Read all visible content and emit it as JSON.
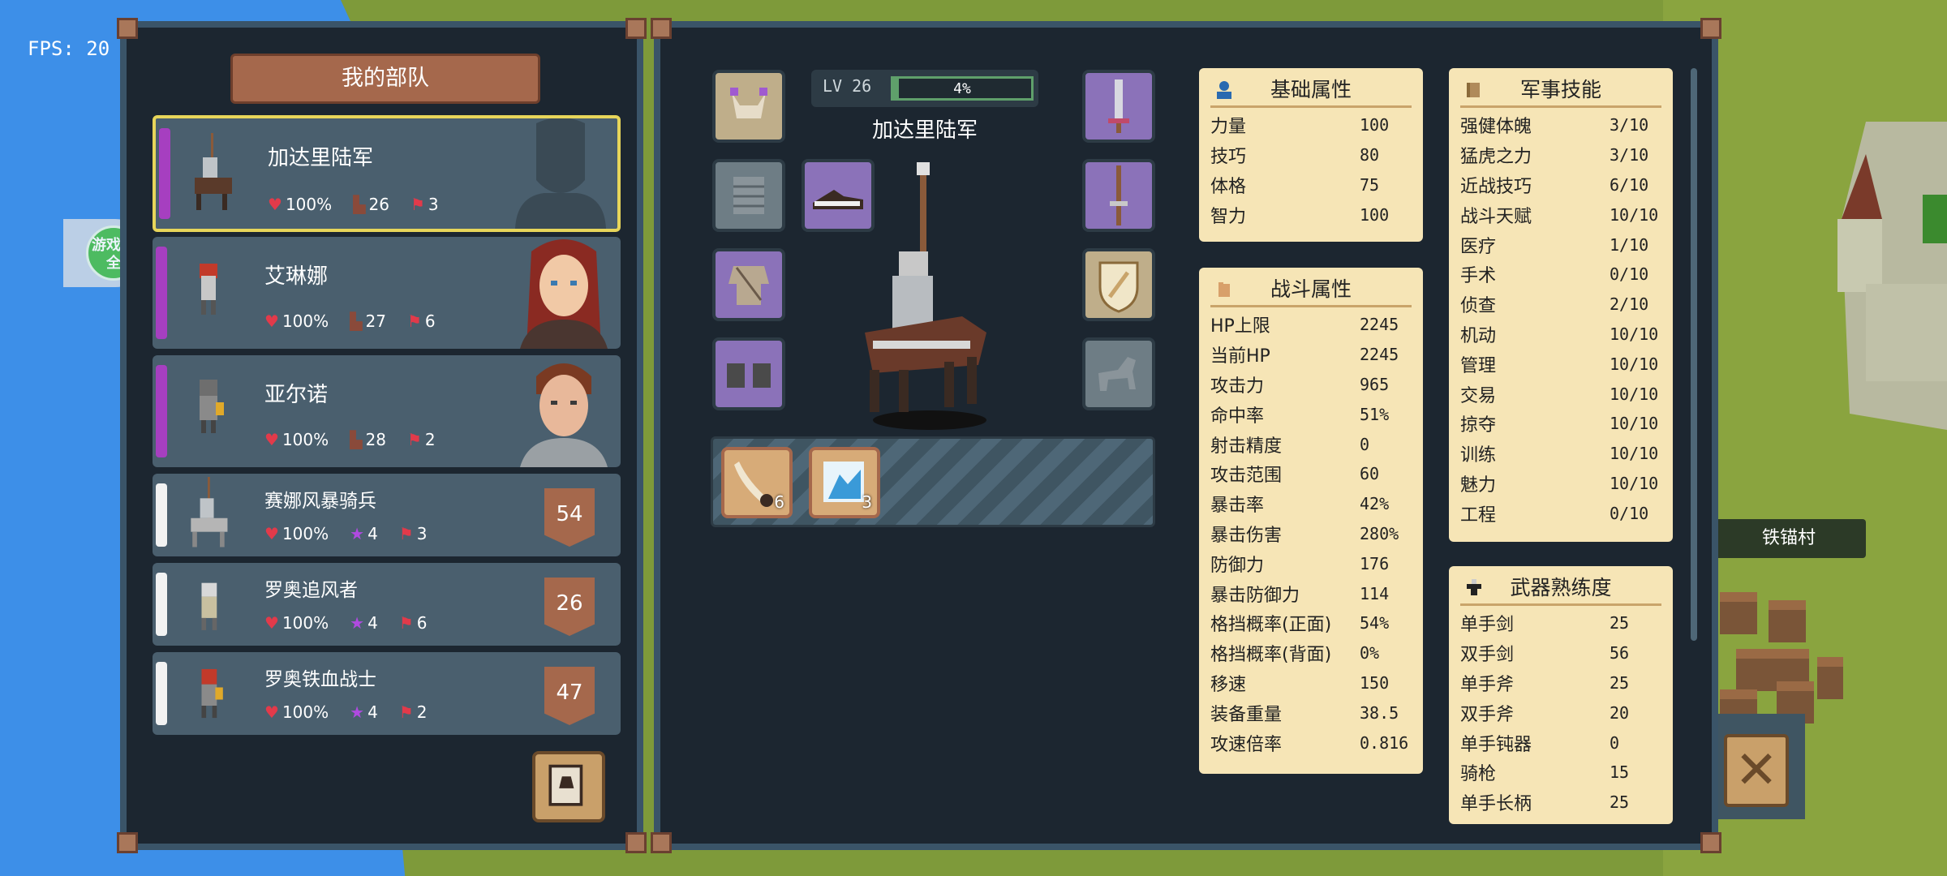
{
  "hud": {
    "fps": "FPS: 20"
  },
  "overlay": {
    "game_box_label": "游戏大全"
  },
  "map": {
    "village_label": "铁锚村"
  },
  "troops": {
    "title": "我的部队",
    "units": [
      {
        "name": "加达里陆军",
        "hp": "100%",
        "level": "26",
        "count": "3",
        "selected": true,
        "bar_color": "#a63fc0",
        "badge": "",
        "portrait": "silhouette"
      },
      {
        "name": "艾琳娜",
        "hp": "100%",
        "level": "27",
        "count": "6",
        "selected": false,
        "bar_color": "#a63fc0",
        "badge": "",
        "portrait": "female"
      },
      {
        "name": "亚尔诺",
        "hp": "100%",
        "level": "28",
        "count": "2",
        "selected": false,
        "bar_color": "#a63fc0",
        "badge": "",
        "portrait": "male"
      },
      {
        "name": "赛娜风暴骑兵",
        "hp": "100%",
        "tier": "4",
        "count": "3",
        "selected": false,
        "bar_color": "#f2f2f2",
        "badge": "54"
      },
      {
        "name": "罗奥追风者",
        "hp": "100%",
        "tier": "4",
        "count": "6",
        "selected": false,
        "bar_color": "#f2f2f2",
        "badge": "26"
      },
      {
        "name": "罗奥铁血战士",
        "hp": "100%",
        "tier": "4",
        "count": "2",
        "selected": false,
        "bar_color": "#f2f2f2",
        "badge": "47"
      }
    ]
  },
  "character": {
    "level_label": "LV 26",
    "xp_percent": 4,
    "xp_text": "4%",
    "name": "加达里陆军",
    "inventory": [
      {
        "icon": "horn-icon",
        "count": "6"
      },
      {
        "icon": "potion-icon",
        "count": "3"
      }
    ]
  },
  "basic_attrs": {
    "title": "基础属性",
    "rows": [
      {
        "k": "力量",
        "v": "100"
      },
      {
        "k": "技巧",
        "v": "80"
      },
      {
        "k": "体格",
        "v": "75"
      },
      {
        "k": "智力",
        "v": "100"
      }
    ]
  },
  "combat_attrs": {
    "title": "战斗属性",
    "rows": [
      {
        "k": "HP上限",
        "v": "2245"
      },
      {
        "k": "当前HP",
        "v": "2245"
      },
      {
        "k": "攻击力",
        "v": "965"
      },
      {
        "k": "命中率",
        "v": "51%"
      },
      {
        "k": "射击精度",
        "v": "0"
      },
      {
        "k": "攻击范围",
        "v": "60"
      },
      {
        "k": "暴击率",
        "v": "42%"
      },
      {
        "k": "暴击伤害",
        "v": "280%"
      },
      {
        "k": "防御力",
        "v": "176"
      },
      {
        "k": "暴击防御力",
        "v": "114"
      },
      {
        "k": "格挡概率(正面)",
        "v": "54%"
      },
      {
        "k": "格挡概率(背面)",
        "v": "0%"
      },
      {
        "k": "移速",
        "v": "150"
      },
      {
        "k": "装备重量",
        "v": "38.5"
      },
      {
        "k": "攻速倍率",
        "v": "0.816"
      }
    ]
  },
  "military_skills": {
    "title": "军事技能",
    "rows": [
      {
        "k": "强健体魄",
        "v": "3/10"
      },
      {
        "k": "猛虎之力",
        "v": "3/10"
      },
      {
        "k": "近战技巧",
        "v": "6/10"
      },
      {
        "k": "战斗天赋",
        "v": "10/10"
      },
      {
        "k": "医疗",
        "v": "1/10"
      },
      {
        "k": "手术",
        "v": "0/10"
      },
      {
        "k": "侦查",
        "v": "2/10"
      },
      {
        "k": "机动",
        "v": "10/10"
      },
      {
        "k": "管理",
        "v": "10/10"
      },
      {
        "k": "交易",
        "v": "10/10"
      },
      {
        "k": "掠夺",
        "v": "10/10"
      },
      {
        "k": "训练",
        "v": "10/10"
      },
      {
        "k": "魅力",
        "v": "10/10"
      },
      {
        "k": "工程",
        "v": "0/10"
      }
    ]
  },
  "weapon_mastery": {
    "title": "武器熟练度",
    "rows": [
      {
        "k": "单手剑",
        "v": "25"
      },
      {
        "k": "双手剑",
        "v": "56"
      },
      {
        "k": "单手斧",
        "v": "25"
      },
      {
        "k": "双手斧",
        "v": "20"
      },
      {
        "k": "单手钝器",
        "v": "0"
      },
      {
        "k": "骑枪",
        "v": "15"
      },
      {
        "k": "单手长柄",
        "v": "25"
      }
    ]
  }
}
